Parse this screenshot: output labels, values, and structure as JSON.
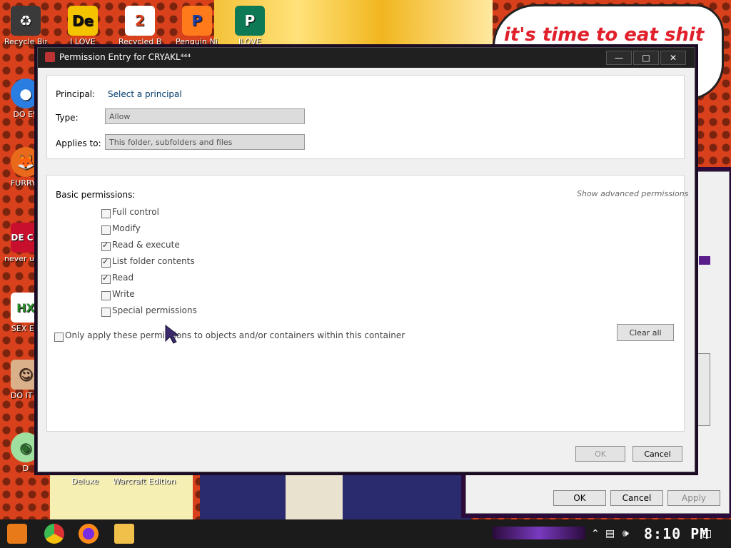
{
  "desktop": {
    "speech_text": "it's time to eat shit",
    "icons": [
      {
        "label": "Recycle Bin",
        "glyph": "♻",
        "color": "#3a3a3a"
      },
      {
        "label": "I LOVE",
        "glyph": "De",
        "color": "#111111"
      },
      {
        "label": "Recycled B",
        "glyph": "2",
        "color": "#d8411c"
      },
      {
        "label": "Penguin Night",
        "glyph": "P",
        "color": "#1b3fa8"
      },
      {
        "label": "ILOVE",
        "glyph": "P",
        "color": "#0e7a55"
      },
      {
        "label": "DO EV",
        "glyph": "●",
        "color": "#2a7de1"
      },
      {
        "label": "FURRYF",
        "glyph": "🦊",
        "color": "#e86a1a"
      },
      {
        "label": "never u why is",
        "glyph": "DE C+",
        "color": "#c8102e"
      },
      {
        "label": "SEX ED",
        "glyph": "HX",
        "color": "#ffffff"
      },
      {
        "label": "DO IT U",
        "glyph": "☺",
        "color": "#b08060"
      },
      {
        "label": "D",
        "glyph": "◉",
        "color": "#9fe0a0"
      }
    ],
    "lower_labels": [
      "Deluxe",
      "Warcraft Edition"
    ]
  },
  "dialog": {
    "title": "Permission Entry for CRYAKL⁴⁴⁴",
    "principal_label": "Principal:",
    "principal_link": "Select a principal",
    "type_label": "Type:",
    "type_value": "Allow",
    "applies_label": "Applies to:",
    "applies_value": "This folder, subfolders and files",
    "basic_label": "Basic permissions:",
    "advanced_link": "Show advanced permissions",
    "permissions": [
      {
        "label": "Full control",
        "checked": false
      },
      {
        "label": "Modify",
        "checked": false
      },
      {
        "label": "Read & execute",
        "checked": true
      },
      {
        "label": "List folder contents",
        "checked": true
      },
      {
        "label": "Read",
        "checked": true
      },
      {
        "label": "Write",
        "checked": false
      },
      {
        "label": "Special permissions",
        "checked": false
      }
    ],
    "only_apply_label": "Only apply these permissions to objects and/or containers within this container",
    "clear_all": "Clear all",
    "ok": "OK",
    "cancel": "Cancel"
  },
  "background_dialog": {
    "ok": "OK",
    "cancel": "Cancel",
    "apply": "Apply"
  },
  "taskbar": {
    "clock": "8:10 PM"
  }
}
